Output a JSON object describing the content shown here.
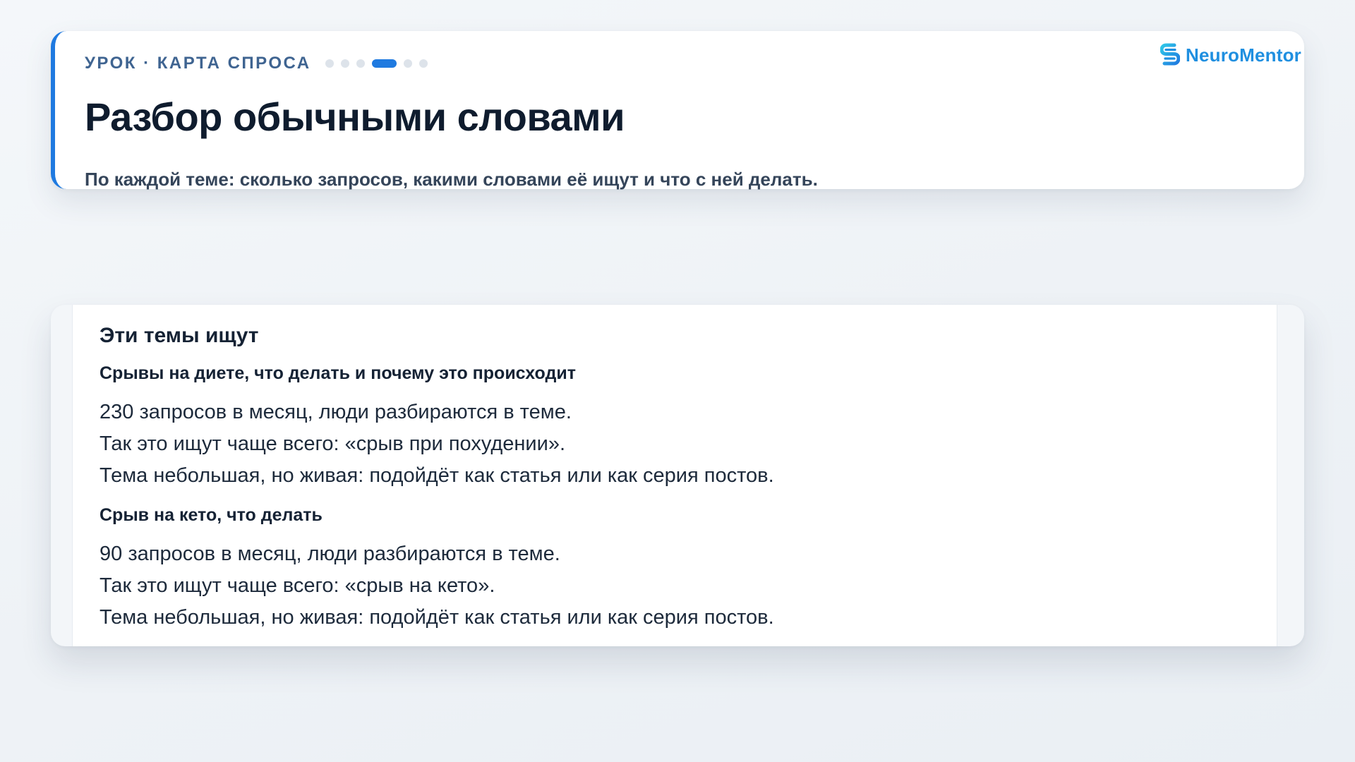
{
  "header": {
    "eyebrow": "УРОК · КАРТА СПРОСА",
    "progress": {
      "total_steps": 6,
      "current_step": 4
    },
    "title": "Разбор обычными словами",
    "subtitle": "По каждой теме: сколько запросов, какими словами её ищут и что с ней делать.",
    "brand": {
      "name": "NeuroMentor",
      "icon": "neuromentor-logo-icon",
      "color": "#1f8fe0"
    },
    "accent_color": "#1f7ae0"
  },
  "content": {
    "section_title": "Эти темы ищут",
    "topics": [
      {
        "title": "Срывы на диете, что делать и почему это происходит",
        "lines": [
          "230 запросов в месяц, люди разбираются в теме.",
          "Так это ищут чаще всего: «срыв при похудении».",
          "Тема небольшая, но живая: подойдёт как статья или как серия постов."
        ]
      },
      {
        "title": "Срыв на кето, что делать",
        "lines": [
          "90 запросов в месяц, люди разбираются в теме.",
          "Так это ищут чаще всего: «срыв на кето».",
          "Тема небольшая, но живая: подойдёт как статья или как серия постов."
        ]
      }
    ]
  }
}
